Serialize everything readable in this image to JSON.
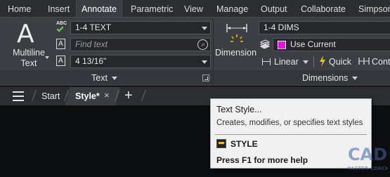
{
  "ribbon_tabs": [
    "Home",
    "Insert",
    "Annotate",
    "Parametric",
    "View",
    "Manage",
    "Output",
    "Collaborate",
    "Simpson"
  ],
  "active_tab": "Annotate",
  "text_panel": {
    "big_button_glyph": "A",
    "big_button_label_line1": "Multiline",
    "big_button_label_line2": "Text",
    "spellcheck_icon_text": "ABC",
    "text_style_value": "1-4 TEXT",
    "find_placeholder": "Find text",
    "text_height_value": "4 13/16\"",
    "panel_title": "Text",
    "style_icon_glyph": "A",
    "height_icon_glyph": "A"
  },
  "dimensions_panel": {
    "button_label": "Dimension",
    "dim_style_value": "1-4 DIMS",
    "layer_value": "Use Current",
    "linear_label": "Linear",
    "quick_label": "Quick",
    "continue_label": "Cont",
    "panel_title": "Dimensions",
    "layer_color": "#ff00ff"
  },
  "file_tabs": {
    "start_label": "Start",
    "active_label": "Style*",
    "close_glyph": "×",
    "new_glyph": "+"
  },
  "tooltip": {
    "title": "Text Style...",
    "description": "Creates, modifies, or specifies text styles",
    "command": "STYLE",
    "help": "Press F1 for more help"
  },
  "watermark": {
    "line1": "CAD",
    "line2": "MASTER COACH"
  },
  "colors": {
    "ribbon_bg": "#3b3e43",
    "tabbar_bg": "#2b2d30",
    "canvas_bg": "#0c0d0f",
    "tooltip_bg": "#f0f0f0",
    "accent_check": "#5fd35f"
  }
}
